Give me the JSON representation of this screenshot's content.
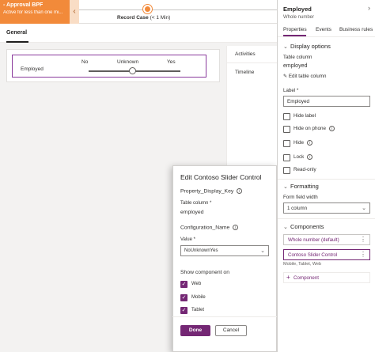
{
  "bpf": {
    "process_name": "- Approval BPF",
    "status": "Active for less than one mi...",
    "chevron": "‹",
    "stage_name": "Record Case",
    "stage_duration": "(< 1 Min)"
  },
  "form": {
    "tab_label": "General",
    "field_label": "Employed",
    "options": [
      "No",
      "Unknown",
      "Yes"
    ],
    "slider_value": "Unknown",
    "side_items": [
      "Activities",
      "Timeline"
    ]
  },
  "dialog": {
    "title": "Edit Contoso Slider Control",
    "property_key": "Property_Display_Key",
    "table_column_label": "Table column *",
    "table_column_value": "employed",
    "configuration_label": "Configuration_Name",
    "value_label": "Value *",
    "value_selected": "NoUnknownYes",
    "show_label": "Show component on",
    "platforms": [
      "Web",
      "Mobile",
      "Tablet"
    ],
    "done_label": "Done",
    "cancel_label": "Cancel"
  },
  "pane": {
    "title": "Employed",
    "subtitle": "Whole number",
    "collapse_glyph": "›",
    "tabs": [
      "Properties",
      "Events",
      "Business rules"
    ],
    "display_options": {
      "heading": "Display options",
      "table_column_label": "Table column",
      "table_column_value": "employed",
      "edit_link": "Edit table column",
      "label_caption": "Label *",
      "label_value": "Employed",
      "checkboxes": [
        "Hide label",
        "Hide on phone",
        "Hide",
        "Lock",
        "Read-only"
      ]
    },
    "formatting": {
      "heading": "Formatting",
      "width_label": "Form field width",
      "width_value": "1 column"
    },
    "components": {
      "heading": "Components",
      "items": [
        "Whole number (default)",
        "Contoso Slider Control"
      ],
      "selected_sub": "Mobile, Tablet, Web",
      "add_label": "Component"
    }
  },
  "colors": {
    "accent": "#742774",
    "bpf_orange": "#f28a3a"
  }
}
